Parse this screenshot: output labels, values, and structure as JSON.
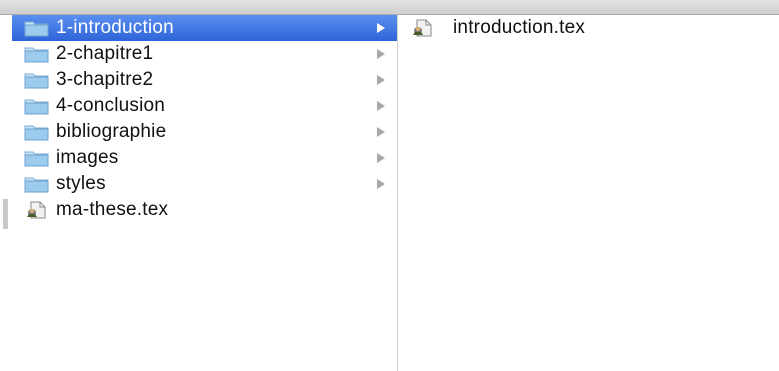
{
  "column1": {
    "items": [
      {
        "label": "1-introduction",
        "type": "folder",
        "selected": true,
        "has_children": true
      },
      {
        "label": "2-chapitre1",
        "type": "folder",
        "selected": false,
        "has_children": true
      },
      {
        "label": "3-chapitre2",
        "type": "folder",
        "selected": false,
        "has_children": true
      },
      {
        "label": "4-conclusion",
        "type": "folder",
        "selected": false,
        "has_children": true
      },
      {
        "label": "bibliographie",
        "type": "folder",
        "selected": false,
        "has_children": true
      },
      {
        "label": "images",
        "type": "folder",
        "selected": false,
        "has_children": true
      },
      {
        "label": "styles",
        "type": "folder",
        "selected": false,
        "has_children": true
      },
      {
        "label": "ma-these.tex",
        "type": "tex-file",
        "selected": false,
        "has_children": false
      }
    ]
  },
  "column2": {
    "items": [
      {
        "label": "introduction.tex",
        "type": "tex-file",
        "selected": false,
        "has_children": false
      }
    ]
  },
  "colors": {
    "selection": "#3a72e0",
    "folder": "#8fc3ea",
    "arrow": "#9a9a9a"
  },
  "icons": {
    "folder": "folder-icon",
    "tex-file": "tex-document-icon",
    "arrow": "disclosure-arrow-icon"
  }
}
